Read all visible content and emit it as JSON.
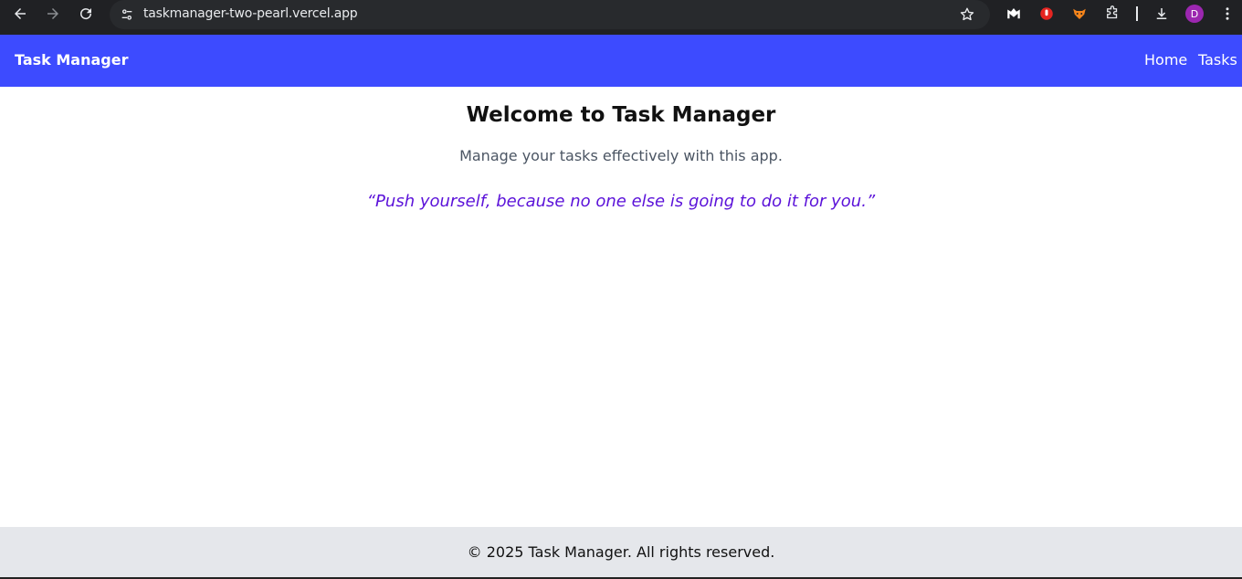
{
  "browser": {
    "url": "taskmanager-two-pearl.vercel.app",
    "profile_initial": "D",
    "icons": {
      "back": "arrow-left-icon",
      "forward": "arrow-right-icon",
      "reload": "reload-icon",
      "site_info": "tune-icon",
      "bookmark": "star-icon",
      "ext1": "m-logo-icon",
      "ext2": "red-extension-icon",
      "ext3": "fox-extension-icon",
      "extensions": "puzzle-icon",
      "download": "download-icon",
      "menu": "kebab-menu-icon"
    }
  },
  "navbar": {
    "brand": "Task Manager",
    "links": [
      "Home",
      "Tasks"
    ],
    "color": "#3d4bff"
  },
  "main": {
    "title": "Welcome to Task Manager",
    "subtitle": "Manage your tasks effectively with this app.",
    "quote": "“Push yourself, because no one else is going to do it for you.”",
    "quote_color": "#5b12d9"
  },
  "footer": {
    "text": "© 2025 Task Manager. All rights reserved.",
    "bg": "#e5e7eb"
  }
}
